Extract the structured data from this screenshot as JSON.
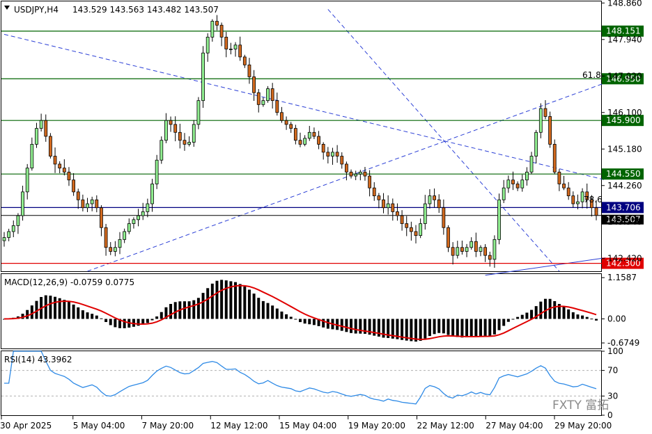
{
  "header": {
    "menu_icon": "triangle-down-icon",
    "symbol": "USDJPY,H4",
    "ohlc": "143.529 143.563 143.482 143.507"
  },
  "chart_data": [
    {
      "type": "candlestick",
      "title": "USDJPY,H4",
      "ylim": [
        142.1,
        148.9
      ],
      "price_ticks": [
        "148.860",
        "147.940",
        "147.020",
        "146.100",
        "145.180",
        "144.260",
        "143.340",
        "142.420"
      ],
      "x_ticks": [
        "30 Apr 2025",
        "5 May 04:00",
        "7 May 20:00",
        "12 May 12:00",
        "15 May 04:00",
        "19 May 20:00",
        "22 May 12:00",
        "27 May 04:00",
        "29 May 20:00"
      ],
      "close": [
        142.95,
        143.1,
        143.25,
        143.5,
        144.1,
        144.7,
        145.3,
        145.7,
        145.9,
        145.5,
        145.0,
        144.8,
        144.7,
        144.6,
        144.4,
        144.1,
        143.9,
        143.7,
        143.8,
        143.9,
        143.7,
        143.2,
        142.7,
        142.6,
        142.7,
        142.9,
        143.1,
        143.3,
        143.4,
        143.5,
        143.6,
        143.8,
        144.3,
        144.9,
        145.4,
        145.9,
        145.8,
        145.6,
        145.4,
        145.3,
        145.35,
        145.8,
        146.4,
        147.6,
        148.0,
        148.4,
        148.3,
        148.0,
        147.7,
        147.7,
        147.8,
        147.5,
        147.3,
        147.0,
        146.6,
        146.3,
        146.4,
        146.7,
        146.4,
        146.1,
        145.9,
        145.8,
        145.7,
        145.4,
        145.3,
        145.45,
        145.6,
        145.5,
        145.3,
        145.1,
        145.0,
        145.1,
        145.0,
        144.8,
        144.6,
        144.5,
        144.55,
        144.6,
        144.5,
        144.2,
        144.0,
        143.9,
        143.7,
        143.8,
        143.6,
        143.5,
        143.3,
        143.2,
        143.1,
        143.0,
        143.3,
        143.8,
        144.0,
        143.9,
        143.7,
        143.2,
        142.7,
        142.5,
        142.7,
        142.6,
        142.7,
        142.85,
        142.6,
        142.7,
        142.5,
        142.4,
        142.9,
        143.9,
        144.2,
        144.4,
        144.3,
        144.2,
        144.4,
        144.6,
        145.0,
        145.6,
        146.2,
        146.0,
        145.3,
        144.6,
        144.3,
        144.2,
        144.0,
        143.8,
        143.85,
        144.1,
        143.9,
        143.7,
        143.507
      ],
      "price_lines": [
        {
          "price": "148.151",
          "color": "#006400"
        },
        {
          "price": "146.950",
          "color": "#006400"
        },
        {
          "price": "145.900",
          "color": "#006400"
        },
        {
          "price": "144.550",
          "color": "#006400"
        },
        {
          "price": "143.706",
          "color": "#000080"
        },
        {
          "price": "142.300",
          "color": "#e00000"
        }
      ],
      "current_price": "143.507",
      "annotations": [
        "61.8",
        "78.6"
      ],
      "colors": {
        "up": "#90ee90",
        "down": "#d2691e",
        "outline": "#000000",
        "trend": "#2b3fd6"
      }
    },
    {
      "type": "bar",
      "title": "MACD(12,26,9) -0.0759 0.0775",
      "ylim": [
        -0.83,
        1.26
      ],
      "y_ticks": [
        "1.1587",
        "0.00",
        "-0.6749"
      ],
      "signal_color": "#e00000"
    },
    {
      "type": "line",
      "title": "RSI(14) 43.3962",
      "ylim": [
        0,
        100
      ],
      "y_ticks": [
        "100",
        "70",
        "30",
        "0"
      ],
      "line_color": "#2e8ae6"
    }
  ],
  "watermark": "FXTY 富拓"
}
